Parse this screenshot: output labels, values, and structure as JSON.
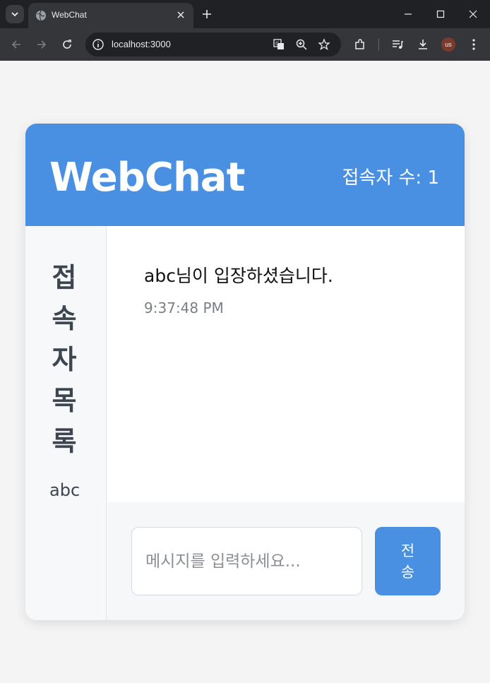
{
  "browser": {
    "tab_title": "WebChat",
    "url": "localhost:3000",
    "profile_initials": "us",
    "icons": [
      "tab-search-icon",
      "globe-icon",
      "close-icon",
      "plus-icon",
      "minimize-icon",
      "maximize-icon",
      "close-window-icon",
      "back-arrow-icon",
      "forward-arrow-icon",
      "reload-icon",
      "site-info-icon",
      "translate-icon",
      "zoom-icon",
      "star-icon",
      "extensions-icon",
      "media-icon",
      "download-icon",
      "more-vert-icon"
    ]
  },
  "header": {
    "title": "WebChat",
    "user_count": "접속자 수: 1"
  },
  "sidebar": {
    "title": "접속자목록",
    "users": [
      "abc"
    ]
  },
  "messages": [
    {
      "text": "abc님이 입장하셨습니다.",
      "time": "9:37:48 PM"
    }
  ],
  "composer": {
    "placeholder": "메시지를 입력하세요...",
    "send_label": "전송"
  },
  "colors": {
    "accent": "#4a90e2",
    "background": "#f4f4f4",
    "sidebar": "#f7f8fa"
  }
}
